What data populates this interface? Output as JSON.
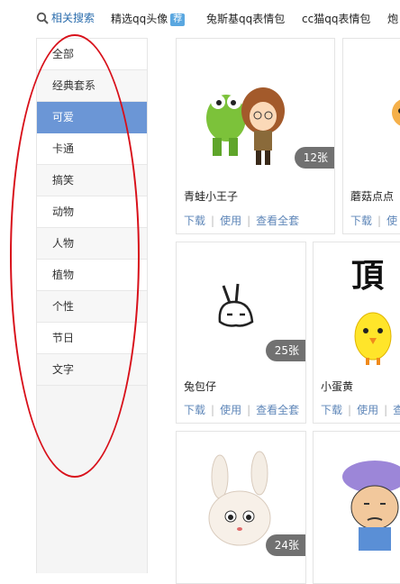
{
  "related_search": {
    "label": "相关搜索",
    "links": [
      {
        "text": "精选qq头像",
        "badge": "荐"
      },
      {
        "text": "兔斯基qq表情包"
      },
      {
        "text": "cc猫qq表情包"
      },
      {
        "text": "炮"
      }
    ]
  },
  "sidebar": {
    "items": [
      {
        "label": "全部"
      },
      {
        "label": "经典套系"
      },
      {
        "label": "可爱"
      },
      {
        "label": "卡通"
      },
      {
        "label": "搞笑"
      },
      {
        "label": "动物"
      },
      {
        "label": "人物"
      },
      {
        "label": "植物"
      },
      {
        "label": "个性"
      },
      {
        "label": "节日"
      },
      {
        "label": "文字"
      }
    ],
    "active_index": 2
  },
  "cards": [
    {
      "name": "青蛙小王子",
      "count": "12张",
      "actions": [
        "下载",
        "使用",
        "查看全套"
      ]
    },
    {
      "name": "蘑菇点点",
      "count": "",
      "actions": [
        "下载",
        "使"
      ]
    },
    {
      "name": "兔包仔",
      "count": "25张",
      "actions": [
        "下载",
        "使用",
        "查看全套"
      ]
    },
    {
      "name": "小蛋黄",
      "count": "",
      "actions": [
        "下载",
        "使用",
        "查"
      ]
    },
    {
      "name": "",
      "count": "24张",
      "actions": []
    },
    {
      "name": "",
      "count": "",
      "actions": []
    }
  ],
  "card5_thumb_text": "頂",
  "colors": {
    "accent": "#6b96d6",
    "link": "#5e86b8",
    "annotation": "#d8101a"
  }
}
